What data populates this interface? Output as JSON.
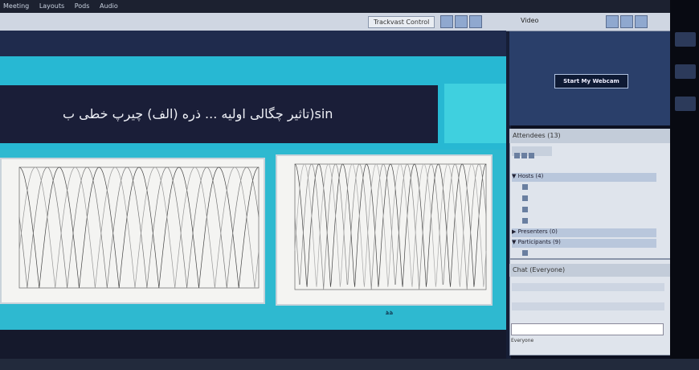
{
  "presenter": {
    "track_control": "Trackvast Control"
  },
  "slide": {
    "title": "تاثیر چگالی اولیه ... ذره (الف) چیرپ خطی ب)sin",
    "page_number": "ﻫﻫ"
  },
  "video": {
    "title": "Video",
    "webcam_button": "Start My Webcam"
  },
  "attendees": {
    "title": "Attendees (13)",
    "groups": [
      {
        "label": "▼ Hosts (4)"
      },
      {
        "label": "▶ Presenters (0)"
      },
      {
        "label": "▼ Participants (9)"
      }
    ]
  },
  "chat": {
    "title": "Chat (Everyone)",
    "footer": "Everyone"
  },
  "colors": {
    "accent": "#27b8d3",
    "dark": "#1a1e38",
    "pod": "#dfe4ec"
  },
  "chart_data": [
    {
      "type": "line",
      "title": "",
      "xlabel": "",
      "ylabel": "",
      "x": [
        0,
        0.25,
        0.5,
        0.75,
        1
      ],
      "series": [
        {
          "name": "",
          "values": [
            1,
            0,
            1,
            0,
            1
          ]
        }
      ]
    },
    {
      "type": "line",
      "title": "",
      "xlabel": "",
      "ylabel": "",
      "ylim": [
        0,
        1.2
      ],
      "x": [
        0,
        0.25,
        0.5,
        0.75,
        1
      ],
      "series": [
        {
          "name": "",
          "values": [
            1,
            0,
            1,
            0,
            1
          ]
        }
      ]
    }
  ]
}
